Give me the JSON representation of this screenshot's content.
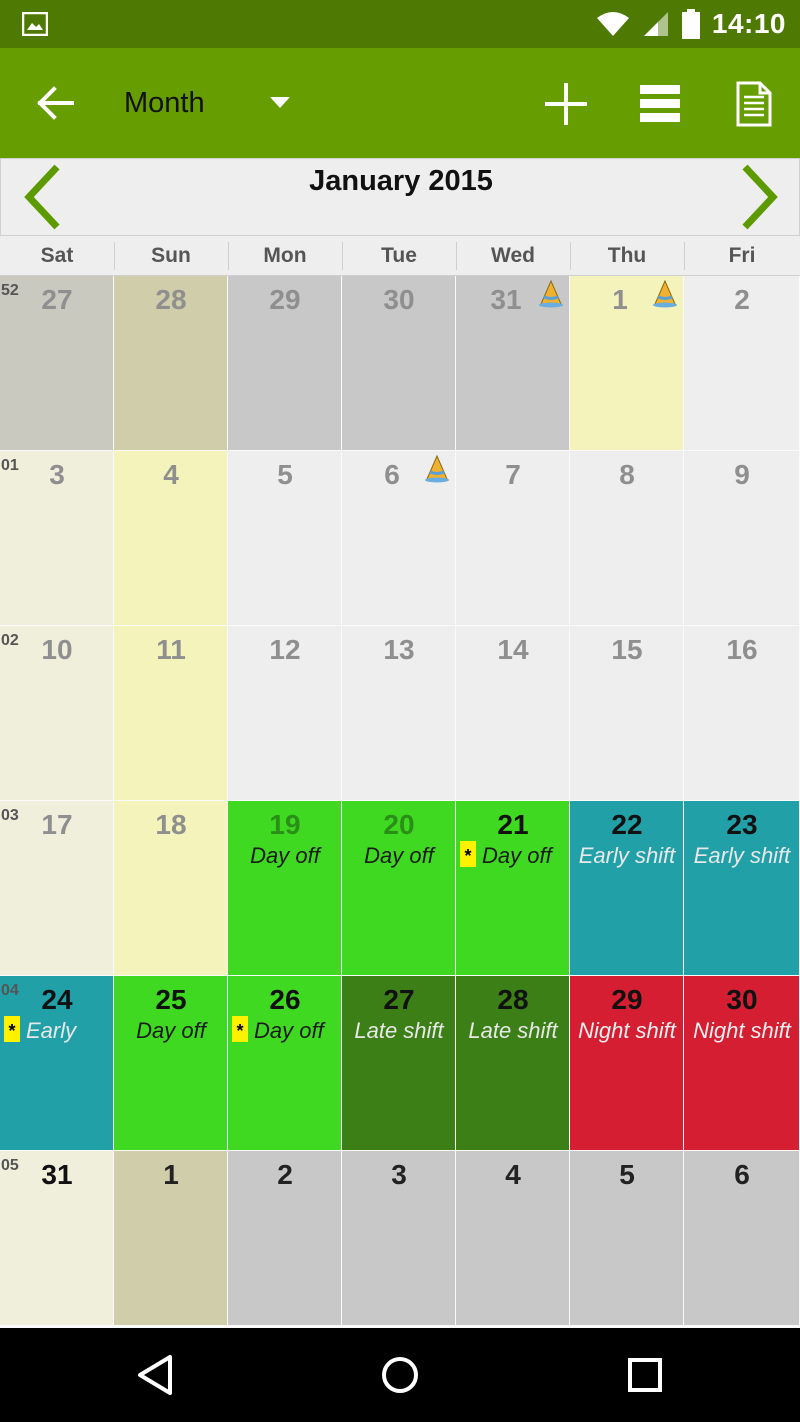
{
  "status_bar": {
    "time": "14:10",
    "icons": [
      "image-notification-icon",
      "wifi-icon",
      "signal-icon",
      "battery-icon"
    ]
  },
  "app_bar": {
    "view_label": "Month",
    "icons": [
      "back-arrow-icon",
      "dropdown-arrow-icon",
      "add-icon",
      "list-view-icon",
      "document-icon"
    ]
  },
  "month_header": {
    "title": "January 2015"
  },
  "weekdays": [
    "Sat",
    "Sun",
    "Mon",
    "Tue",
    "Wed",
    "Thu",
    "Fri"
  ],
  "colors": {
    "status_bar": "#4e7a04",
    "app_bar": "#669d00",
    "nav_arrow": "#5c9a00",
    "day_off": "#3fd921",
    "early_shift": "#21a0a8",
    "late_shift": "#3b7f16",
    "night_shift": "#d51e32",
    "highlight": "#fff200"
  },
  "weeks": [
    {
      "week_no": "52",
      "days": [
        {
          "day": "27",
          "bg": "#c9c9bf",
          "fg": "#8f8f8f",
          "label": "",
          "star": false,
          "hat": false
        },
        {
          "day": "28",
          "bg": "#cfcdaa",
          "fg": "#8f8f8f",
          "label": "",
          "star": false,
          "hat": false
        },
        {
          "day": "29",
          "bg": "#c8c8c8",
          "fg": "#8f8f8f",
          "label": "",
          "star": false,
          "hat": false
        },
        {
          "day": "30",
          "bg": "#c8c8c8",
          "fg": "#8f8f8f",
          "label": "",
          "star": false,
          "hat": false
        },
        {
          "day": "31",
          "bg": "#c8c8c8",
          "fg": "#8f8f8f",
          "label": "",
          "star": false,
          "hat": true
        },
        {
          "day": "1",
          "bg": "#f3f3bb",
          "fg": "#8f8f8f",
          "label": "",
          "star": false,
          "hat": true
        },
        {
          "day": "2",
          "bg": "#eeeeee",
          "fg": "#8f8f8f",
          "label": "",
          "star": false,
          "hat": false
        }
      ]
    },
    {
      "week_no": "01",
      "days": [
        {
          "day": "3",
          "bg": "#f0efdc",
          "fg": "#8f8f8f",
          "label": "",
          "star": false,
          "hat": false
        },
        {
          "day": "4",
          "bg": "#f3f3bb",
          "fg": "#8f8f8f",
          "label": "",
          "star": false,
          "hat": false
        },
        {
          "day": "5",
          "bg": "#eeeeee",
          "fg": "#8f8f8f",
          "label": "",
          "star": false,
          "hat": false
        },
        {
          "day": "6",
          "bg": "#eeeeee",
          "fg": "#8f8f8f",
          "label": "",
          "star": false,
          "hat": true
        },
        {
          "day": "7",
          "bg": "#eeeeee",
          "fg": "#8f8f8f",
          "label": "",
          "star": false,
          "hat": false
        },
        {
          "day": "8",
          "bg": "#eeeeee",
          "fg": "#8f8f8f",
          "label": "",
          "star": false,
          "hat": false
        },
        {
          "day": "9",
          "bg": "#eeeeee",
          "fg": "#8f8f8f",
          "label": "",
          "star": false,
          "hat": false
        }
      ]
    },
    {
      "week_no": "02",
      "days": [
        {
          "day": "10",
          "bg": "#f0efdc",
          "fg": "#8f8f8f",
          "label": "",
          "star": false,
          "hat": false
        },
        {
          "day": "11",
          "bg": "#f3f3bb",
          "fg": "#8f8f8f",
          "label": "",
          "star": false,
          "hat": false
        },
        {
          "day": "12",
          "bg": "#eeeeee",
          "fg": "#8f8f8f",
          "label": "",
          "star": false,
          "hat": false
        },
        {
          "day": "13",
          "bg": "#eeeeee",
          "fg": "#8f8f8f",
          "label": "",
          "star": false,
          "hat": false
        },
        {
          "day": "14",
          "bg": "#eeeeee",
          "fg": "#8f8f8f",
          "label": "",
          "star": false,
          "hat": false
        },
        {
          "day": "15",
          "bg": "#eeeeee",
          "fg": "#8f8f8f",
          "label": "",
          "star": false,
          "hat": false
        },
        {
          "day": "16",
          "bg": "#eeeeee",
          "fg": "#8f8f8f",
          "label": "",
          "star": false,
          "hat": false
        }
      ]
    },
    {
      "week_no": "03",
      "days": [
        {
          "day": "17",
          "bg": "#f0efdc",
          "fg": "#8f8f8f",
          "label": "",
          "star": false,
          "hat": false
        },
        {
          "day": "18",
          "bg": "#f3f3bb",
          "fg": "#8f8f8f",
          "label": "",
          "star": false,
          "hat": false
        },
        {
          "day": "19",
          "bg": "#3fd921",
          "fg": "#2a8f17",
          "label": "Day off",
          "label_color": "#1a1a1a",
          "star": false,
          "hat": false
        },
        {
          "day": "20",
          "bg": "#3fd921",
          "fg": "#2a8f17",
          "label": "Day off",
          "label_color": "#1a1a1a",
          "star": false,
          "hat": false
        },
        {
          "day": "21",
          "bg": "#3fd921",
          "fg": "#111111",
          "label": "Day off",
          "label_color": "#1a1a1a",
          "star": true,
          "hat": false
        },
        {
          "day": "22",
          "bg": "#21a0a8",
          "fg": "#111111",
          "label": "Early shift",
          "label_color": "#e8e8e8",
          "star": false,
          "hat": false
        },
        {
          "day": "23",
          "bg": "#21a0a8",
          "fg": "#111111",
          "label": "Early shift",
          "label_color": "#e8e8e8",
          "star": false,
          "hat": false
        }
      ]
    },
    {
      "week_no": "04",
      "days": [
        {
          "day": "24",
          "bg": "#21a0a8",
          "fg": "#111111",
          "label": "Early",
          "label_color": "#e8e8e8",
          "star": true,
          "hat": false
        },
        {
          "day": "25",
          "bg": "#3fd921",
          "fg": "#111111",
          "label": "Day off",
          "label_color": "#1a1a1a",
          "star": false,
          "hat": false
        },
        {
          "day": "26",
          "bg": "#3fd921",
          "fg": "#111111",
          "label": "Day off",
          "label_color": "#1a1a1a",
          "star": true,
          "hat": false
        },
        {
          "day": "27",
          "bg": "#3b7f16",
          "fg": "#111111",
          "label": "Late shift",
          "label_color": "#e8e8e8",
          "star": false,
          "hat": false
        },
        {
          "day": "28",
          "bg": "#3b7f16",
          "fg": "#111111",
          "label": "Late shift",
          "label_color": "#e8e8e8",
          "star": false,
          "hat": false
        },
        {
          "day": "29",
          "bg": "#d51e32",
          "fg": "#111111",
          "label": "Night shift",
          "label_color": "#f0f0f0",
          "star": false,
          "hat": false
        },
        {
          "day": "30",
          "bg": "#d51e32",
          "fg": "#111111",
          "label": "Night shift",
          "label_color": "#f0f0f0",
          "star": false,
          "hat": false
        }
      ]
    },
    {
      "week_no": "05",
      "days": [
        {
          "day": "31",
          "bg": "#f0efdc",
          "fg": "#111111",
          "label": "",
          "star": false,
          "hat": false
        },
        {
          "day": "1",
          "bg": "#cfcdaa",
          "fg": "#222222",
          "label": "",
          "star": false,
          "hat": false
        },
        {
          "day": "2",
          "bg": "#c8c8c8",
          "fg": "#222222",
          "label": "",
          "star": false,
          "hat": false
        },
        {
          "day": "3",
          "bg": "#c8c8c8",
          "fg": "#222222",
          "label": "",
          "star": false,
          "hat": false
        },
        {
          "day": "4",
          "bg": "#c8c8c8",
          "fg": "#222222",
          "label": "",
          "star": false,
          "hat": false
        },
        {
          "day": "5",
          "bg": "#c8c8c8",
          "fg": "#222222",
          "label": "",
          "star": false,
          "hat": false
        },
        {
          "day": "6",
          "bg": "#c8c8c8",
          "fg": "#222222",
          "label": "",
          "star": false,
          "hat": false
        }
      ]
    }
  ],
  "nav_bar": {
    "icons": [
      "back-triangle-icon",
      "home-circle-icon",
      "recents-square-icon"
    ]
  }
}
